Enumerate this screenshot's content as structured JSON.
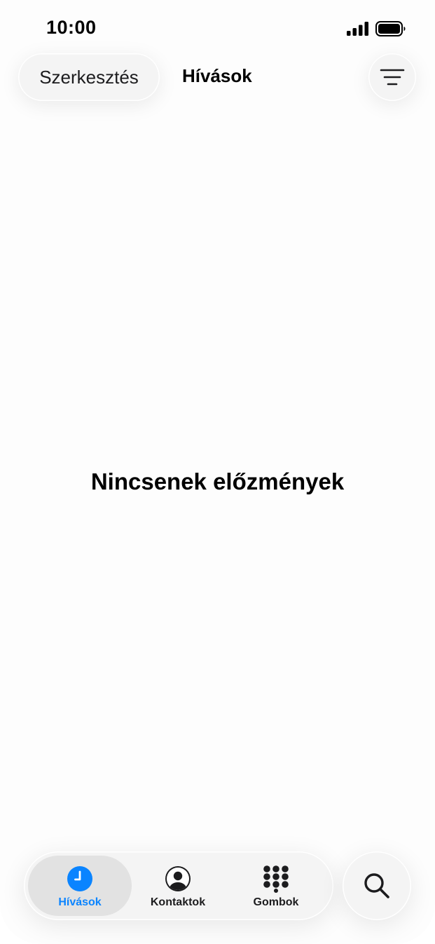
{
  "status_bar": {
    "time": "10:00",
    "signal_icon": "cellular-signal-icon",
    "battery_icon": "battery-icon"
  },
  "header": {
    "edit_label": "Szerkesztés",
    "title": "Hívások",
    "filter_icon": "filter-lines-icon"
  },
  "main": {
    "empty_message": "Nincsenek előzmények"
  },
  "tab_bar": {
    "tabs": [
      {
        "label": "Hívások",
        "icon": "clock-icon",
        "active": true
      },
      {
        "label": "Kontaktok",
        "icon": "person-circle-icon",
        "active": false
      },
      {
        "label": "Gombok",
        "icon": "keypad-grid-icon",
        "active": false
      }
    ],
    "search_icon": "search-icon"
  },
  "colors": {
    "accent": "#0a84ff",
    "text": "#000000",
    "control_background": "#f4f4f4"
  }
}
